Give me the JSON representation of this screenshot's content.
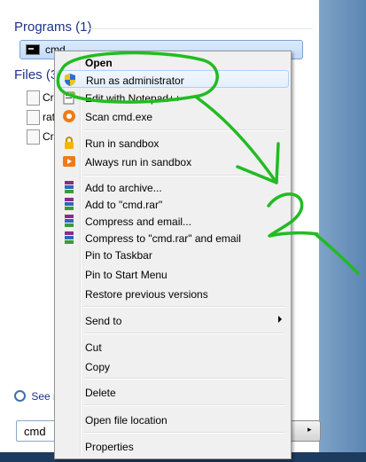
{
  "start_menu": {
    "programs_title": "Programs (1)",
    "program_result": "cmd.",
    "files_title": "Files (3",
    "files": [
      "Cr",
      "rat",
      "Cr"
    ],
    "see_more": "See m",
    "search_value": "cmd"
  },
  "context_menu": {
    "items": [
      {
        "label": "Open",
        "bold": true,
        "icon": "none"
      },
      {
        "label": "Run as administrator",
        "icon": "uac-shield-icon"
      },
      {
        "label": "Edit with Notepad++",
        "icon": "notepad-plus-plus-icon"
      },
      {
        "label": "Scan cmd.exe",
        "icon": "antivirus-scan-icon"
      },
      {
        "label": "Run in sandbox",
        "icon": "sandbox-lock-icon"
      },
      {
        "label": "Always run in sandbox",
        "icon": "sandbox-play-icon"
      },
      {
        "label": "Add to archive...",
        "icon": "winrar-icon"
      },
      {
        "label": "Add to \"cmd.rar\"",
        "icon": "winrar-icon"
      },
      {
        "label": "Compress and email...",
        "icon": "winrar-icon"
      },
      {
        "label": "Compress to \"cmd.rar\" and email",
        "icon": "winrar-icon"
      },
      {
        "label": "Pin to Taskbar",
        "icon": "none"
      },
      {
        "label": "Pin to Start Menu",
        "icon": "none"
      },
      {
        "label": "Restore previous versions",
        "icon": "none"
      },
      {
        "label": "Send to",
        "icon": "none",
        "submenu": true
      },
      {
        "label": "Cut",
        "icon": "none"
      },
      {
        "label": "Copy",
        "icon": "none"
      },
      {
        "label": "Delete",
        "icon": "none"
      },
      {
        "label": "Open file location",
        "icon": "none"
      },
      {
        "label": "Properties",
        "icon": "none"
      }
    ]
  },
  "annotation": {
    "number": "2",
    "color": "#22bb22"
  }
}
